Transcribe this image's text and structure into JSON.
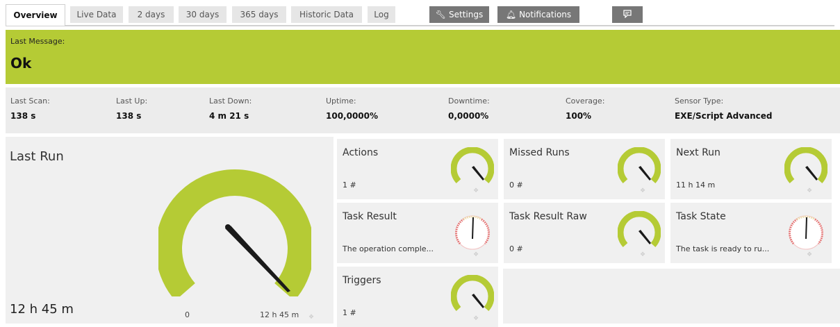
{
  "tabs": [
    {
      "label": "Overview"
    },
    {
      "label": "Live Data"
    },
    {
      "label": "2 days"
    },
    {
      "label": "30 days"
    },
    {
      "label": "365 days"
    },
    {
      "label": "Historic Data"
    },
    {
      "label": "Log"
    },
    {
      "label": "Settings",
      "icon": "wrench-icon"
    },
    {
      "label": "Notifications",
      "icon": "bell-icon"
    },
    {
      "label": "",
      "icon": "comment-icon"
    }
  ],
  "message": {
    "label": "Last Message:",
    "value": "Ok"
  },
  "stats": [
    {
      "label": "Last Scan:",
      "value": "138 s"
    },
    {
      "label": "Last Up:",
      "value": "138 s"
    },
    {
      "label": "Last Down:",
      "value": "4 m 21 s"
    },
    {
      "label": "Uptime:",
      "value": "100,0000%"
    },
    {
      "label": "Downtime:",
      "value": "0,0000%"
    },
    {
      "label": "Coverage:",
      "value": "100%"
    },
    {
      "label": "Sensor Type:",
      "value": "EXE/Script Advanced"
    }
  ],
  "main_gauge": {
    "title": "Last Run",
    "value": "12 h 45 m",
    "min": "0",
    "max": "12 h 45 m",
    "level": 1.0
  },
  "channels": [
    {
      "title": "Actions",
      "value": "1 #",
      "gauge": "green"
    },
    {
      "title": "Missed Runs",
      "value": "0 #",
      "gauge": "green"
    },
    {
      "title": "Next Run",
      "value": "11 h 14 m",
      "gauge": "green"
    },
    {
      "title": "Task Result",
      "value": "The operation comple...",
      "gauge": "lookup"
    },
    {
      "title": "Task Result Raw",
      "value": "0 #",
      "gauge": "green"
    },
    {
      "title": "Task State",
      "value": "The task is ready to ru...",
      "gauge": "lookup"
    },
    {
      "title": "Triggers",
      "value": "1 #",
      "gauge": "green"
    }
  ],
  "colors": {
    "accent": "#b5cb35",
    "panel": "#f0f0f0",
    "dark_tab": "#777777"
  }
}
